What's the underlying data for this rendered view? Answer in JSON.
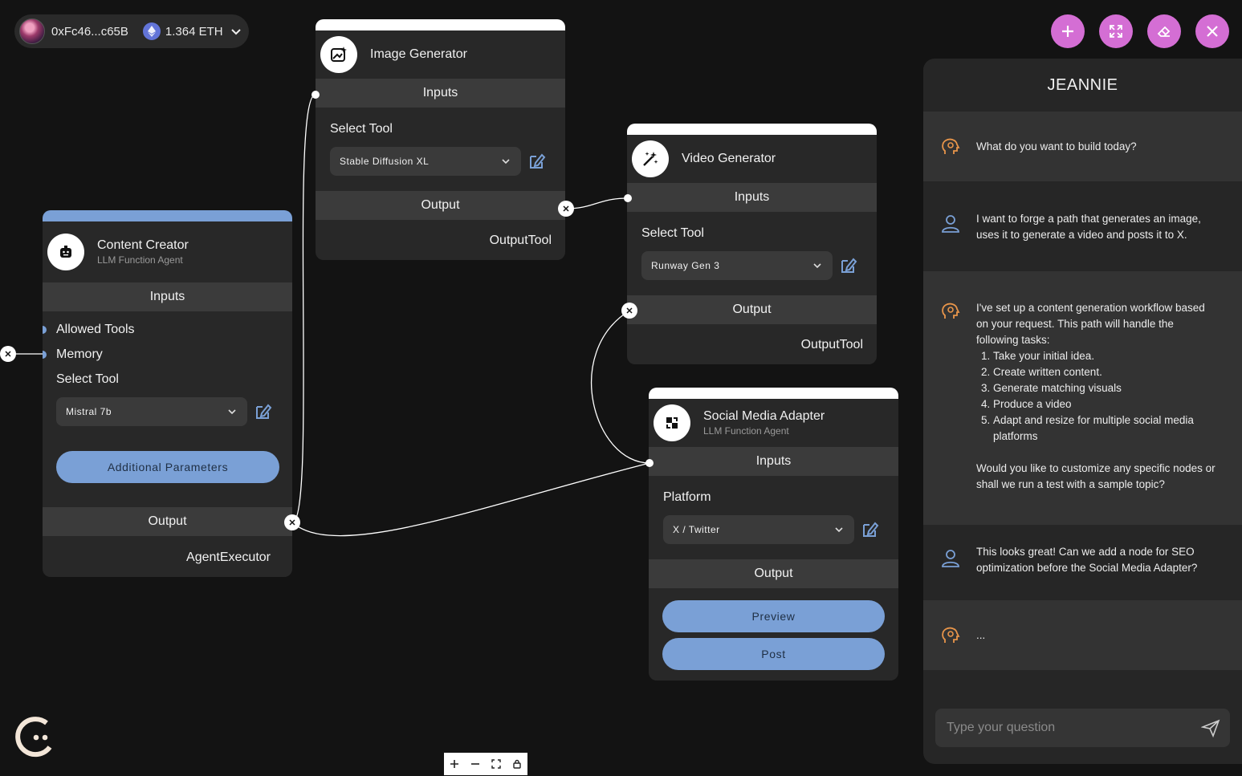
{
  "wallet": {
    "address": "0xFc46...c65B",
    "balance": "1.364 ETH"
  },
  "nodes": {
    "content_creator": {
      "title": "Content Creator",
      "subtitle": "LLM Function Agent",
      "inputs_label": "Inputs",
      "fields": [
        "Allowed Tools",
        "Memory"
      ],
      "select_label": "Select Tool",
      "select_value": "Mistral 7b",
      "params_button": "Additional Parameters",
      "output_label": "Output",
      "output_value": "AgentExecutor"
    },
    "image_generator": {
      "title": "Image Generator",
      "inputs_label": "Inputs",
      "select_label": "Select Tool",
      "select_value": "Stable Diffusion XL",
      "output_label": "Output",
      "output_value": "OutputTool"
    },
    "video_generator": {
      "title": "Video Generator",
      "inputs_label": "Inputs",
      "select_label": "Select Tool",
      "select_value": "Runway Gen 3",
      "output_label": "Output",
      "output_value": "OutputTool"
    },
    "social_media": {
      "title": "Social Media Adapter",
      "subtitle": "LLM Function Agent",
      "inputs_label": "Inputs",
      "select_label": "Platform",
      "select_value": "X / Twitter",
      "output_label": "Output",
      "preview_button": "Preview",
      "post_button": "Post"
    }
  },
  "chat": {
    "title": "JEANNIE",
    "messages": [
      {
        "role": "bot",
        "text": "What do you want to build today?"
      },
      {
        "role": "user",
        "text": "I want to forge a path that generates an image, uses it to generate a video and posts it to X."
      },
      {
        "role": "bot",
        "intro": "I've set up a content generation workflow based on your request. This path will handle the following tasks:",
        "steps": [
          "Take your initial idea.",
          "Create written content.",
          "Generate matching visuals",
          "Produce a video",
          "Adapt and resize for multiple social media platforms"
        ],
        "outro": "Would you like to customize any specific nodes or shall we run a test with a sample topic?"
      },
      {
        "role": "user",
        "text": "This looks great! Can we add a node for SEO optimization before the Social Media Adapter?"
      },
      {
        "role": "bot",
        "text": "..."
      }
    ],
    "input_placeholder": "Type your question"
  },
  "colors": {
    "accent": "#7aa0d6",
    "action": "#d46ed4",
    "bot_icon": "#e8954a",
    "user_icon": "#7aa0d6"
  }
}
